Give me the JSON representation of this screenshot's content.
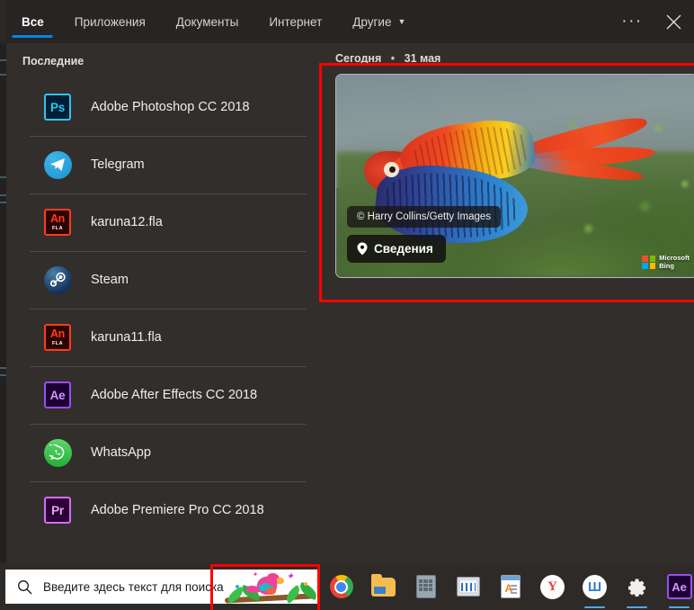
{
  "header": {
    "tabs": [
      {
        "label": "Все",
        "active": true
      },
      {
        "label": "Приложения",
        "active": false
      },
      {
        "label": "Документы",
        "active": false
      },
      {
        "label": "Интернет",
        "active": false
      },
      {
        "label": "Другие",
        "active": false,
        "has_chevron": true
      }
    ],
    "more_label": "···",
    "close_label": "✕"
  },
  "recent": {
    "title": "Последние",
    "items": [
      {
        "label": "Adobe Photoshop CC 2018",
        "icon": "photoshop-icon",
        "glyph": "Ps"
      },
      {
        "label": "Telegram",
        "icon": "telegram-icon",
        "glyph": ""
      },
      {
        "label": "karuna12.fla",
        "icon": "adobe-animate-fla-icon",
        "glyph": "An",
        "sub": "FLA"
      },
      {
        "label": "Steam",
        "icon": "steam-icon",
        "glyph": ""
      },
      {
        "label": "karuna11.fla",
        "icon": "adobe-animate-fla-icon",
        "glyph": "An",
        "sub": "FLA"
      },
      {
        "label": "Adobe After Effects CC 2018",
        "icon": "after-effects-icon",
        "glyph": "Ae"
      },
      {
        "label": "WhatsApp",
        "icon": "whatsapp-icon",
        "glyph": ""
      },
      {
        "label": "Adobe Premiere Pro CC 2018",
        "icon": "premiere-pro-icon",
        "glyph": "Pr"
      }
    ]
  },
  "bing_card": {
    "date_today": "Сегодня",
    "date_separator": "•",
    "date_value": "31 мая",
    "credit": "© Harry Collins/Getty Images",
    "info_button": "Сведения",
    "logo_line1": "Microsoft",
    "logo_line2": "Bing",
    "image_subject": "scarlet macaw in flight"
  },
  "taskbar": {
    "search_placeholder": "Введите здесь текст для поиска",
    "search_value": "",
    "search_icon": "search-icon",
    "icons": [
      {
        "name": "chrome-icon",
        "label": "Google Chrome",
        "running": false
      },
      {
        "name": "file-explorer-icon",
        "label": "Проводник",
        "running": false
      },
      {
        "name": "calculator-icon",
        "label": "Калькулятор",
        "running": false
      },
      {
        "name": "system-monitor-icon",
        "label": "Монитор",
        "running": false
      },
      {
        "name": "document-app-icon",
        "label": "Документ",
        "running": false
      },
      {
        "name": "yandex-icon",
        "label": "Y",
        "running": false
      },
      {
        "name": "sh-app-icon",
        "label": "Ш",
        "running": true
      },
      {
        "name": "settings-gear-icon",
        "label": "Параметры",
        "running": true
      },
      {
        "name": "after-effects-taskbar-icon",
        "label": "Ae",
        "running": true
      }
    ]
  },
  "annotations": {
    "bing_card_highlight": "red-box-around-bing-image-card",
    "parrot_highlight": "red-box-around-search-parrot-illustration",
    "color": "#ff0000"
  },
  "colors": {
    "panel_bg": "#322e2c",
    "header_bg": "#272423",
    "taskbar_bg": "#2e2a28",
    "accent_blue": "#0a84e0",
    "annotation_red": "#ff0000"
  }
}
